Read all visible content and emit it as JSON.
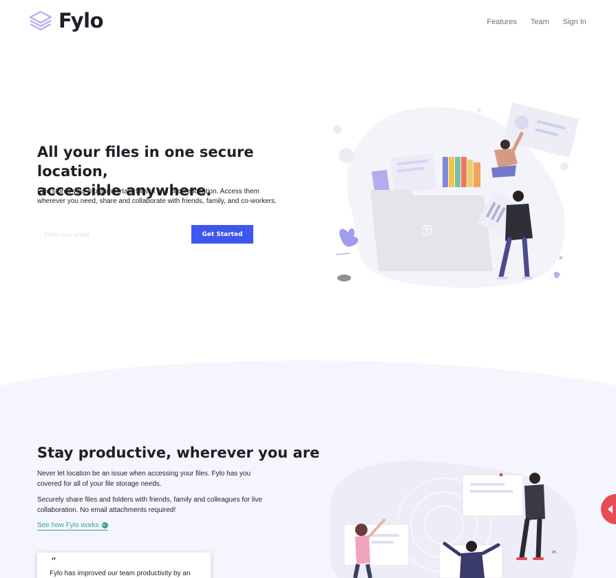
{
  "brand": {
    "name": "Fylo"
  },
  "nav": {
    "features": "Features",
    "team": "Team",
    "sign_in": "Sign In"
  },
  "hero": {
    "title_line1": "All your files in one secure location,",
    "title_line2": "accessible anywhere.",
    "description": "Fylo stores your most important files in one secure location. Access them wherever you need, share and collaborate with friends, family, and co-workers.",
    "email_placeholder": "Enter your email...",
    "cta_label": "Get Started"
  },
  "productive": {
    "title": "Stay productive, wherever you are",
    "paragraph1": "Never let location be an issue when accessing your files. Fylo has you covered for all of your file storage needs.",
    "paragraph2": "Securely share files and folders with friends, family and colleagues for live collaboration. No email attachments required!",
    "link_label": "See how Fylo works"
  },
  "testimonial": {
    "quote_mark": "“",
    "text": "Fylo has improved our team productivity by an"
  },
  "colors": {
    "accent_blue": "#3d57ef",
    "link_teal": "#3ba18d",
    "heading": "#1e1f26",
    "section_bg": "#f5f6fd",
    "side_tab_red": "#e94a53"
  },
  "icons": {
    "logo": "stacked-layers-icon",
    "link_arrow": "arrow-circle-right-icon",
    "side_tab": "caret-left-icon"
  }
}
